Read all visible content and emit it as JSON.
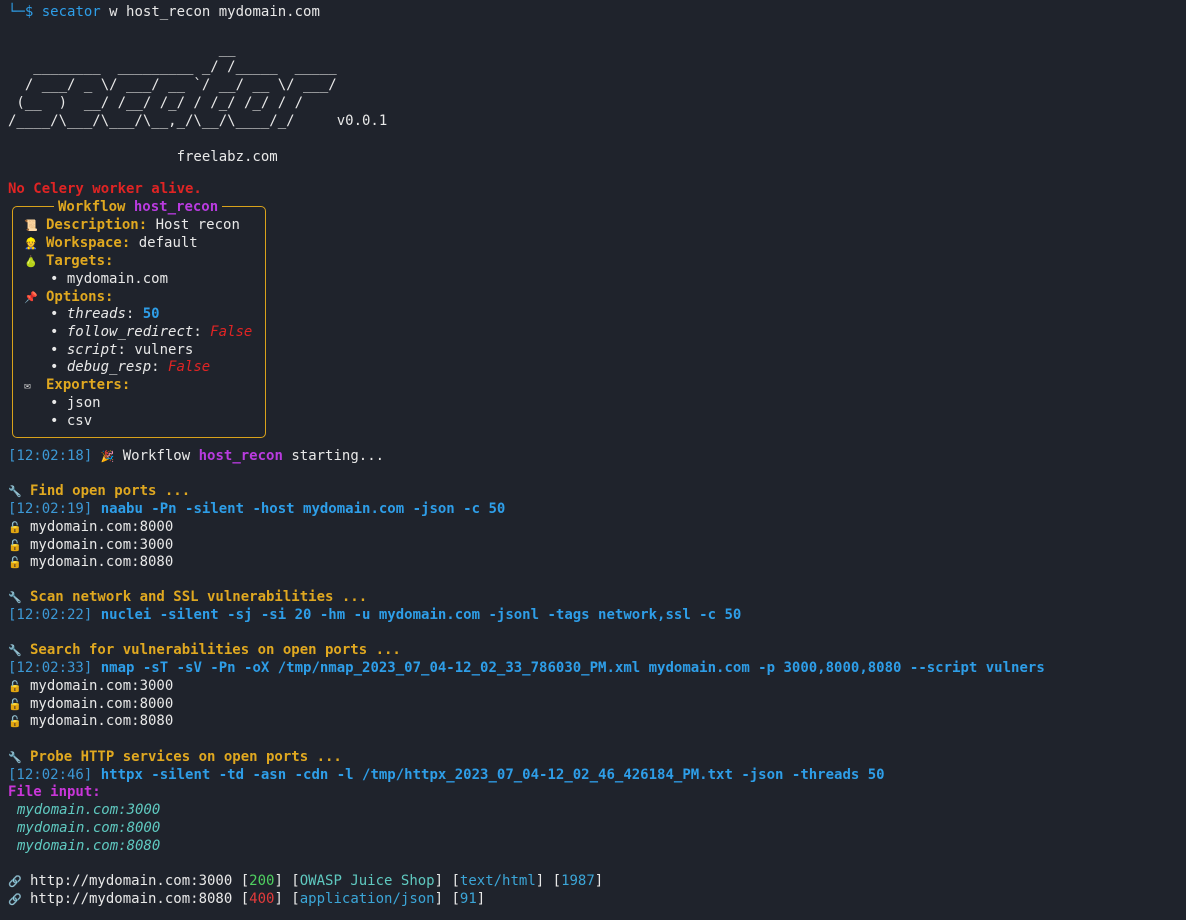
{
  "prompt": {
    "corner": "└─",
    "symbol": "$",
    "command": "secator",
    "args": " w host_recon mydomain.com"
  },
  "banner": {
    "ascii_lines": [
      "                         __",
      "   ________  _________ _/ /_____  _____",
      "  / ___/ _ \\/ ___/ __ `/ __/ __ \\/ ___/",
      " (__  )  __/ /__/ /_/ / /_/ /_/ / /",
      "/____/\\___/\\___/\\__,_/\\__/\\____/_/     v0.0.1",
      "",
      "                    freelabz.com"
    ]
  },
  "warning": "No Celery worker alive.",
  "workflow_box": {
    "title_label": "Workflow",
    "title_name": "host_recon",
    "description_label": "Description:",
    "description": "Host recon",
    "workspace_label": "Workspace:",
    "workspace": "default",
    "targets_label": "Targets:",
    "targets": [
      "mydomain.com"
    ],
    "options_label": "Options:",
    "options": [
      {
        "key": "threads",
        "value": "50"
      },
      {
        "key": "follow_redirect",
        "value": "False"
      },
      {
        "key": "script",
        "value": "vulners"
      },
      {
        "key": "debug_resp",
        "value": "False"
      }
    ],
    "exporters_label": "Exporters:",
    "exporters": [
      "json",
      "csv"
    ],
    "bullet": "•",
    "icons": {
      "description": "scroll-icon",
      "workspace": "person-icon",
      "targets": "pear-icon",
      "options": "pushpin-icon",
      "exporters": "envelope-icon"
    }
  },
  "start_line": {
    "ts": "[12:02:18]",
    "word": "Workflow",
    "name": "host_recon",
    "rest": "starting...",
    "icon": "party-icon"
  },
  "tasks": [
    {
      "title": "Find open ports ...",
      "ts": "[12:02:19]",
      "cmd": "naabu -Pn -silent -host mydomain.com -json -c 50",
      "results": [
        "mydomain.com:8000",
        "mydomain.com:3000",
        "mydomain.com:8080"
      ]
    },
    {
      "title": "Scan network and SSL vulnerabilities ...",
      "ts": "[12:02:22]",
      "cmd": "nuclei -silent -sj -si 20 -hm -u mydomain.com -jsonl -tags network,ssl -c 50",
      "results": []
    },
    {
      "title": "Search for vulnerabilities on open ports ...",
      "ts": "[12:02:33]",
      "cmd": "nmap -sT -sV -Pn -oX /tmp/nmap_2023_07_04-12_02_33_786030_PM.xml mydomain.com -p 3000,8000,8080 --script vulners",
      "results": [
        "mydomain.com:3000",
        "mydomain.com:8000",
        "mydomain.com:8080"
      ]
    },
    {
      "title": "Probe HTTP services on open ports ...",
      "ts": "[12:02:46]",
      "cmd": "httpx -silent -td -asn -cdn -l /tmp/httpx_2023_07_04-12_02_46_426184_PM.txt -json -threads 50",
      "results": []
    }
  ],
  "file_input": {
    "label": "File input:",
    "items": [
      "mydomain.com:3000",
      "mydomain.com:8000",
      "mydomain.com:8080"
    ]
  },
  "http_results": [
    {
      "url": "http://mydomain.com:3000",
      "status": "200",
      "title": "OWASP Juice Shop",
      "ctype": "text/html",
      "length": "1987"
    },
    {
      "url": "http://mydomain.com:8080",
      "status": "400",
      "title": "",
      "ctype": "application/json",
      "length": "91"
    }
  ],
  "colors": {
    "background": "#1f232c",
    "accent_gold": "#e0a820",
    "accent_purple": "#b93be0",
    "accent_blue": "#2e9ee8",
    "error_red": "#e02424"
  }
}
